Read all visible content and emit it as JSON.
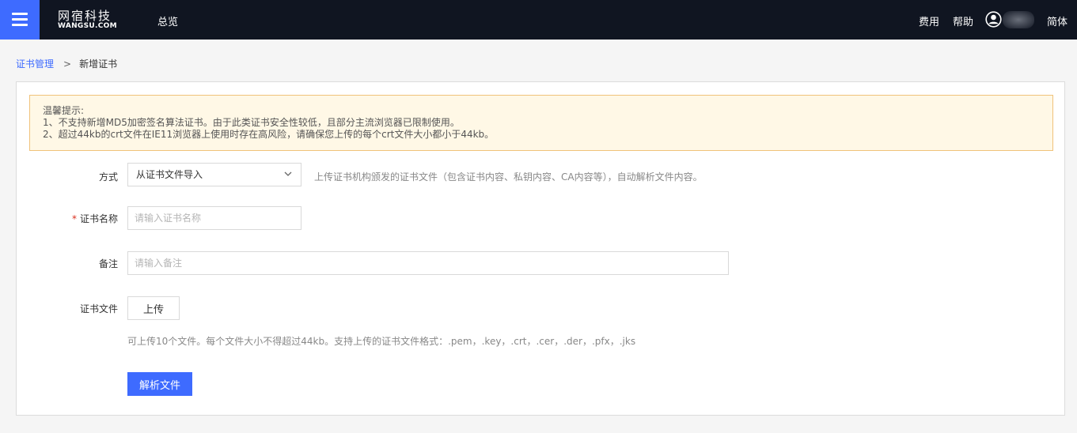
{
  "header": {
    "logo_cn": "网宿科技",
    "logo_en": "WANGSU.COM",
    "nav_overview": "总览",
    "fees": "费用",
    "help": "帮助",
    "language": "简体"
  },
  "breadcrumb": {
    "parent": "证书管理",
    "separator": ">",
    "current": "新增证书"
  },
  "notice": {
    "title": "温馨提示:",
    "line1": "1、不支持新增MD5加密签名算法证书。由于此类证书安全性较低，且部分主流浏览器已限制使用。",
    "line2": "2、超过44kb的crt文件在IE11浏览器上使用时存在高风险，请确保您上传的每个crt文件大小都小于44kb。"
  },
  "form": {
    "method_label": "方式",
    "method_value": "从证书文件导入",
    "method_hint": "上传证书机构颁发的证书文件（包含证书内容、私钥内容、CA内容等），自动解析文件内容。",
    "name_required": "*",
    "name_label": "证书名称",
    "name_placeholder": "请输入证书名称",
    "note_label": "备注",
    "note_placeholder": "请输入备注",
    "file_label": "证书文件",
    "upload_label": "上传",
    "upload_hint": "可上传10个文件。每个文件大小不得超过44kb。支持上传的证书文件格式：.pem，.key，.crt，.cer，.der，.pfx，.jks",
    "parse_label": "解析文件"
  },
  "colors": {
    "primary": "#3e6bff",
    "topbar": "#101521",
    "notice_bg": "#fff8e6",
    "notice_border": "#f0c27a",
    "required": "#d9301f"
  }
}
